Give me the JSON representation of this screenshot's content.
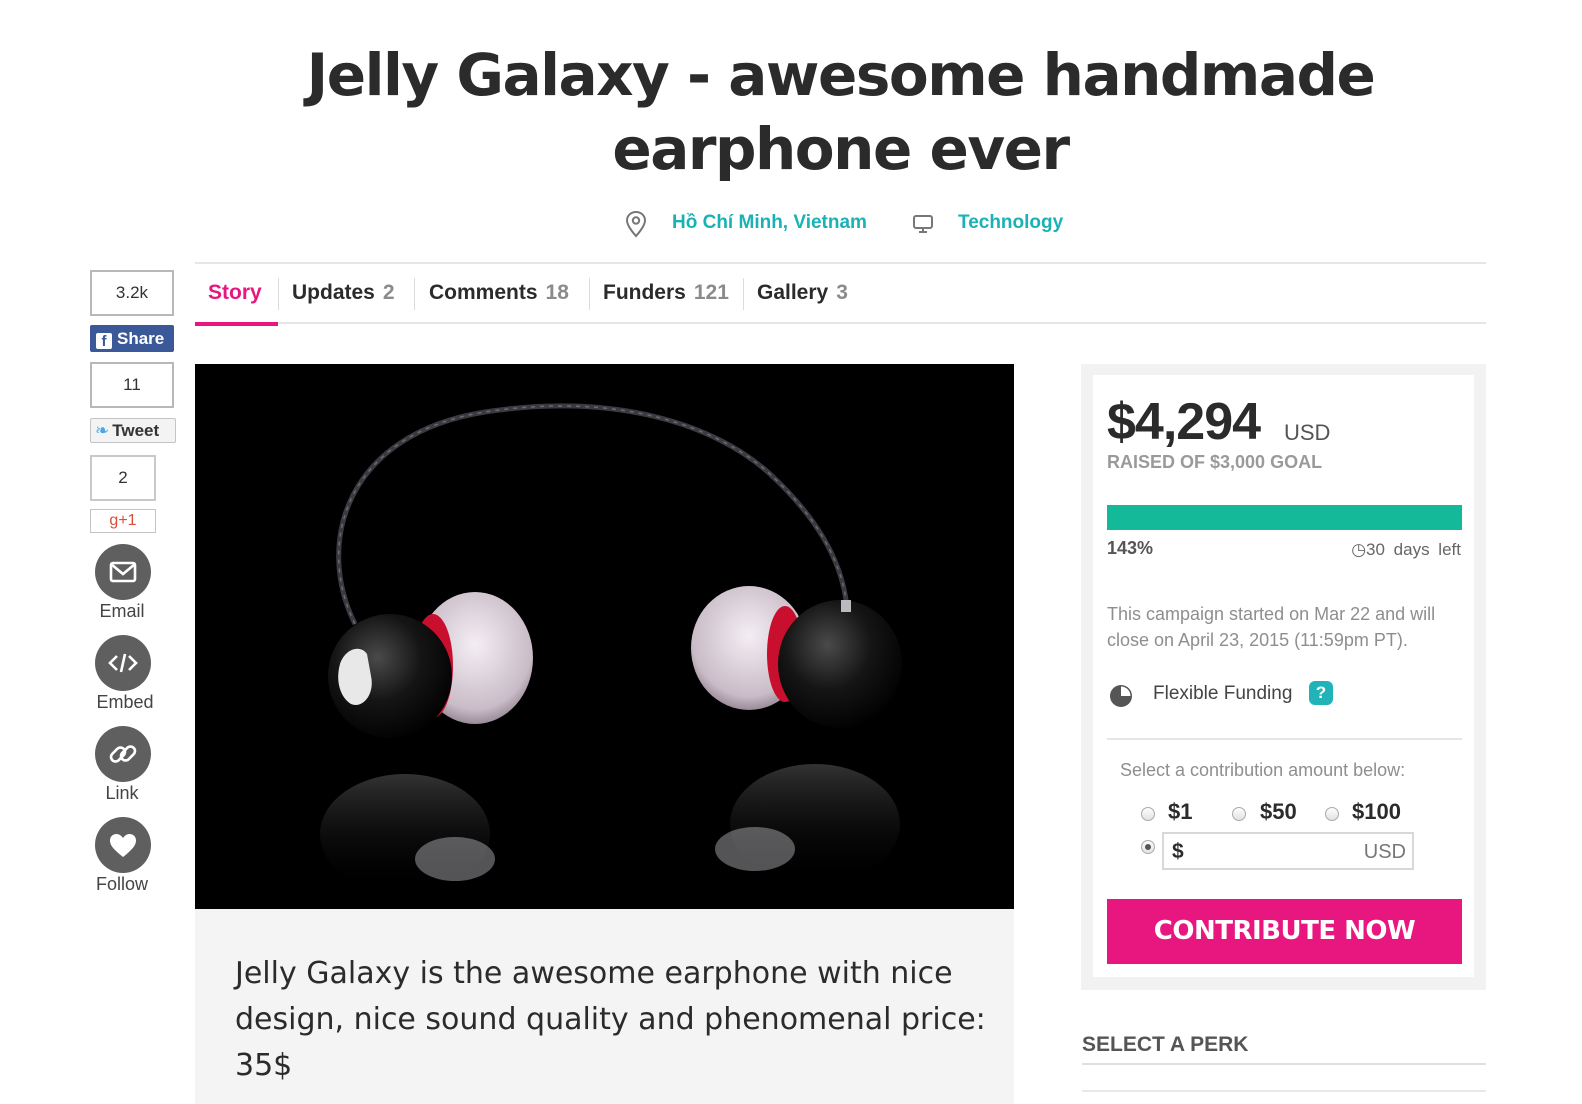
{
  "campaign": {
    "title": "Jelly Galaxy - awesome handmade earphone ever",
    "location": "Hồ Chí Minh, Vietnam",
    "category": "Technology"
  },
  "tabs": [
    {
      "label": "Story",
      "count": ""
    },
    {
      "label": "Updates",
      "count": "2"
    },
    {
      "label": "Comments",
      "count": "18"
    },
    {
      "label": "Funders",
      "count": "121"
    },
    {
      "label": "Gallery",
      "count": "3"
    }
  ],
  "social": {
    "facebook_count": "3.2k",
    "facebook_label": "Share",
    "twitter_count": "11",
    "twitter_label": "Tweet",
    "gplus_count": "2",
    "gplus_label": "g+1",
    "email_label": "Email",
    "embed_label": "Embed",
    "link_label": "Link",
    "follow_label": "Follow"
  },
  "description": "Jelly Galaxy is the awesome earphone with nice design, nice sound quality and phenomenal price: 35$",
  "funding": {
    "amount": "$4,294",
    "currency": "USD",
    "goal_text": "RAISED OF $3,000 GOAL",
    "percent": "143%",
    "percent_value": 143,
    "days_left": "30 days left",
    "campaign_info": "This campaign started on Mar 22 and will close on April 23, 2015 (11:59pm PT).",
    "funding_type": "Flexible Funding",
    "help_glyph": "?",
    "contribution_prompt": "Select a contribution amount below:",
    "amounts": [
      "$1",
      "$50",
      "$100"
    ],
    "custom_prefix": "$",
    "custom_currency": "USD",
    "button_label": "CONTRIBUTE NOW"
  },
  "perks": {
    "title": "SELECT A PERK"
  },
  "colors": {
    "accent_pink": "#e8177f",
    "teal_link": "#1ab2b5",
    "progress_green": "#14b99a",
    "facebook_blue": "#3b5998"
  }
}
